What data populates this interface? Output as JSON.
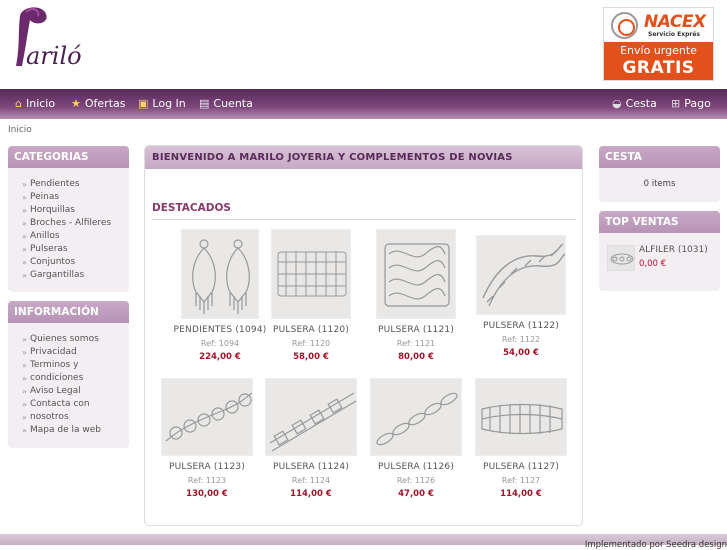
{
  "logo": {
    "text": "Mariló"
  },
  "promo": {
    "brand": "NACEX",
    "subtitle": "Servicio Exprés",
    "line1": "Envío urgente",
    "line2": "GRATIS"
  },
  "nav": {
    "left": [
      {
        "label": "Inicio",
        "icon": "home-icon"
      },
      {
        "label": "Ofertas",
        "icon": "star-icon"
      },
      {
        "label": "Log In",
        "icon": "lock-icon"
      },
      {
        "label": "Cuenta",
        "icon": "account-card-icon"
      }
    ],
    "right": [
      {
        "label": "Cesta",
        "icon": "basket-icon"
      },
      {
        "label": "Pago",
        "icon": "cart-icon"
      }
    ]
  },
  "breadcrumb": "Inicio",
  "categories": {
    "title": "CATEGORIAS",
    "items": [
      "Pendientes",
      "Peinas",
      "Horquillas",
      "Broches - Alfileres",
      "Anillos",
      "Pulseras",
      "Conjuntos",
      "Gargantillas"
    ]
  },
  "info": {
    "title": "INFORMACIÓN",
    "items": [
      "Quienes somos",
      "Privacidad",
      "Terminos y",
      "condiciones",
      "Aviso Legal",
      "Contacta con",
      "nosotros",
      "Mapa de la web"
    ]
  },
  "main": {
    "title": "BIENVENIDO A MARILO JOYERIA Y COMPLEMENTOS DE NOVIAS",
    "section": "DESTACADOS",
    "products": [
      {
        "name": "PENDIENTES (1094)",
        "ref": "Ref: 1094",
        "price": "224,00 €"
      },
      {
        "name": "PULSERA (1120)",
        "ref": "Ref: 1120",
        "price": "58,00 €"
      },
      {
        "name": "PULSERA (1121)",
        "ref": "Ref: 1121",
        "price": "80,00 €"
      },
      {
        "name": "PULSERA (1122)",
        "ref": "Ref: 1122",
        "price": "54,00 €"
      },
      {
        "name": "PULSERA (1123)",
        "ref": "Ref: 1123",
        "price": "130,00 €"
      },
      {
        "name": "PULSERA (1124)",
        "ref": "Ref: 1124",
        "price": "114,00 €"
      },
      {
        "name": "PULSERA (1126)",
        "ref": "Ref: 1126",
        "price": "47,00 €"
      },
      {
        "name": "PULSERA (1127)",
        "ref": "Ref: 1127",
        "price": "114,00 €"
      }
    ]
  },
  "cart": {
    "title": "CESTA",
    "text": "0 items"
  },
  "top_sales": {
    "title": "TOP VENTAS",
    "item_name": "ALFILER (1031)",
    "item_price": "0,00 €"
  },
  "footer": {
    "text": "Implementado por Seedra design"
  },
  "colors": {
    "nav": "#6b3668",
    "box_title": "#c0a0be",
    "price": "#a0142a",
    "promo": "#e2501b"
  }
}
